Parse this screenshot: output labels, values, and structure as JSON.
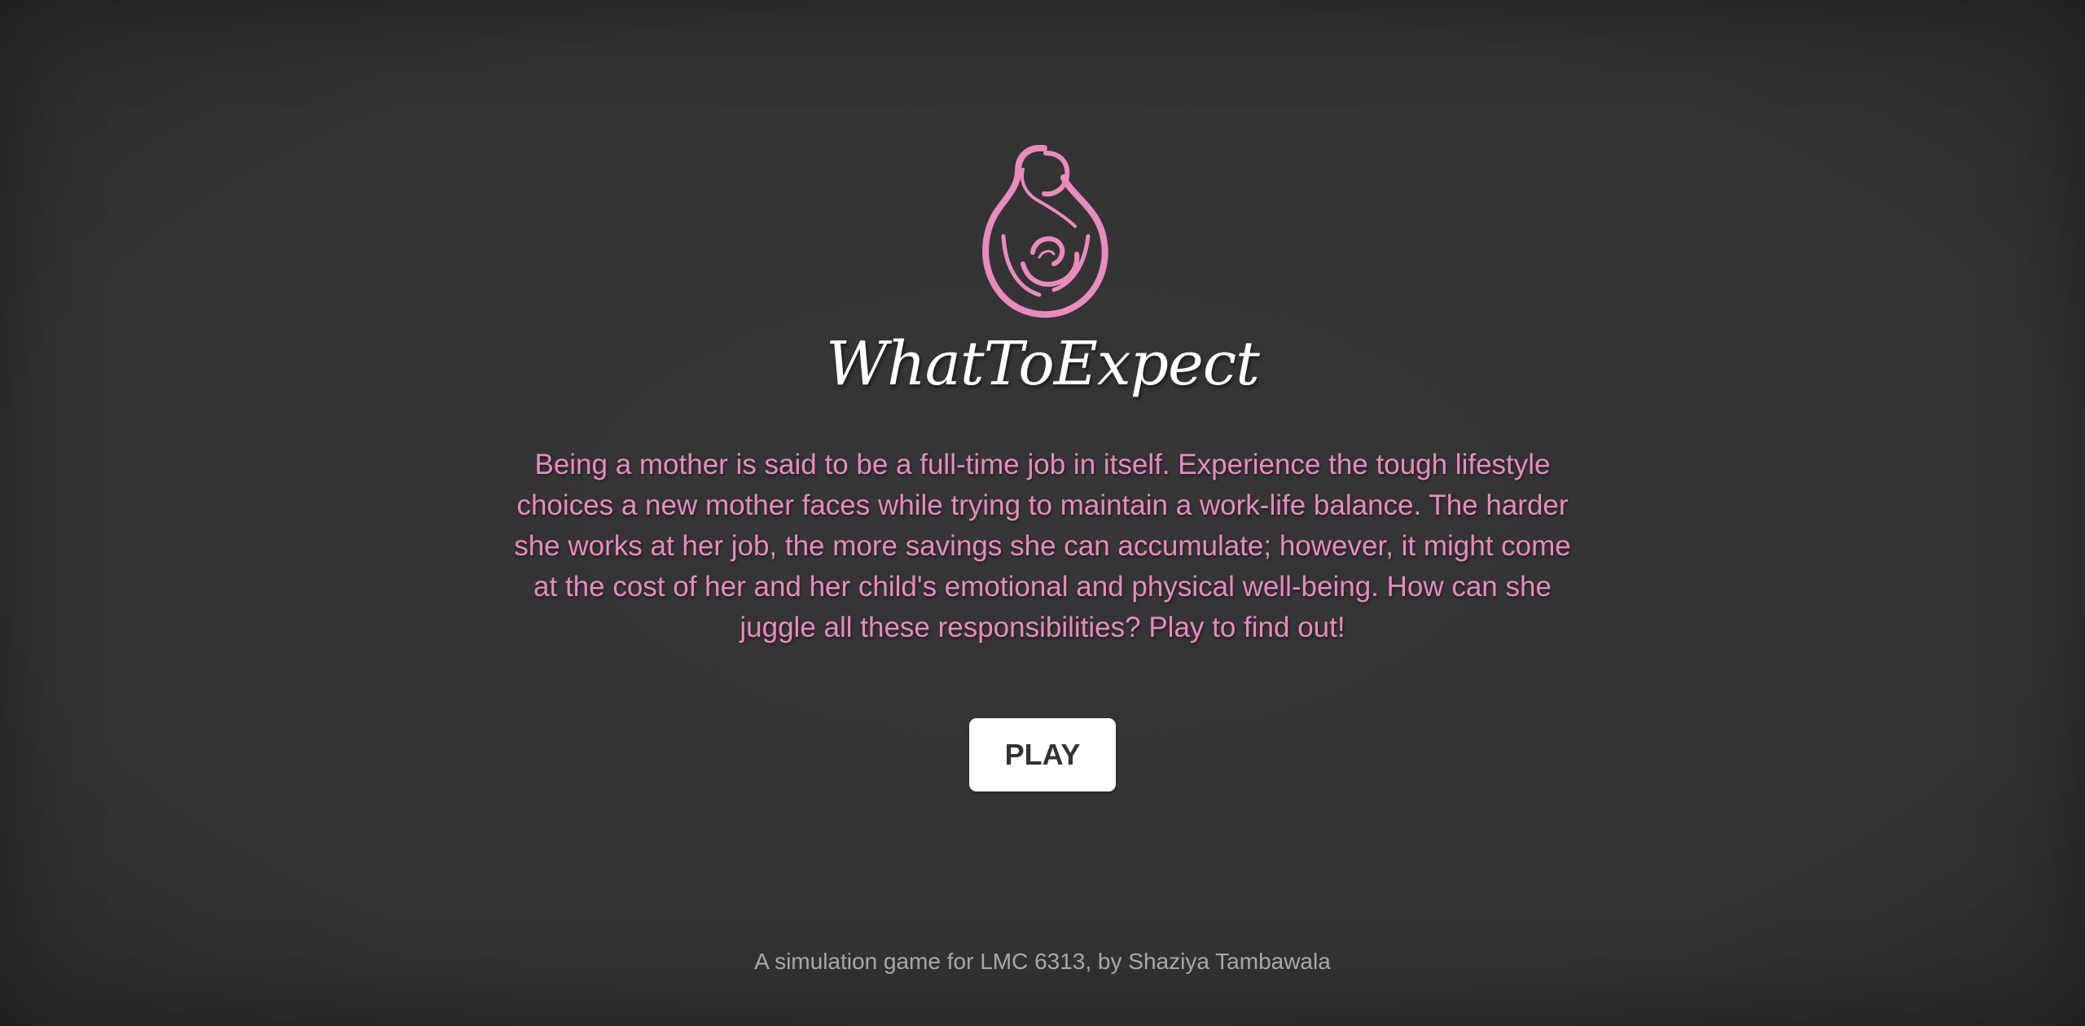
{
  "app": {
    "logo_icon": "mother-holding-baby-icon",
    "accent_color": "#e98bbd",
    "title": "WhatToExpect",
    "description": "Being a mother is said to be a full-time job in itself. Experience the tough lifestyle choices a new mother faces while trying to maintain a work-life balance. The harder she works at her job, the more savings she can accumulate; however, it might come at the cost of her and her child's emotional and physical well-being. How can she juggle all these responsibilities? Play to find out!",
    "play_label": "PLAY",
    "footer": "A simulation game for LMC 6313, by Shaziya Tambawala"
  }
}
